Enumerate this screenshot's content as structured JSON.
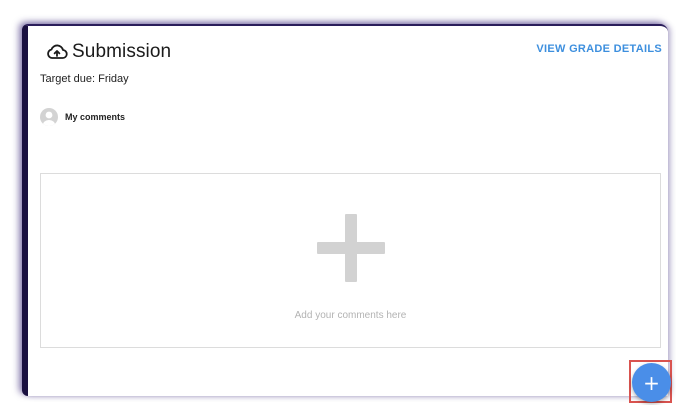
{
  "header": {
    "title": "Submission",
    "icon": "cloud-upload-icon",
    "view_grade_label": "VIEW GRADE DETAILS"
  },
  "due": {
    "text": "Target due: Friday"
  },
  "comments": {
    "label": "My comments",
    "avatar_icon": "user-avatar-icon",
    "placeholder": "Add your comments here",
    "add_icon": "plus-icon"
  },
  "fab": {
    "icon": "plus-icon",
    "glyph": "+",
    "color": "#4a8ee8"
  },
  "colors": {
    "link": "#3d8fde",
    "highlight": "#d9534f"
  }
}
